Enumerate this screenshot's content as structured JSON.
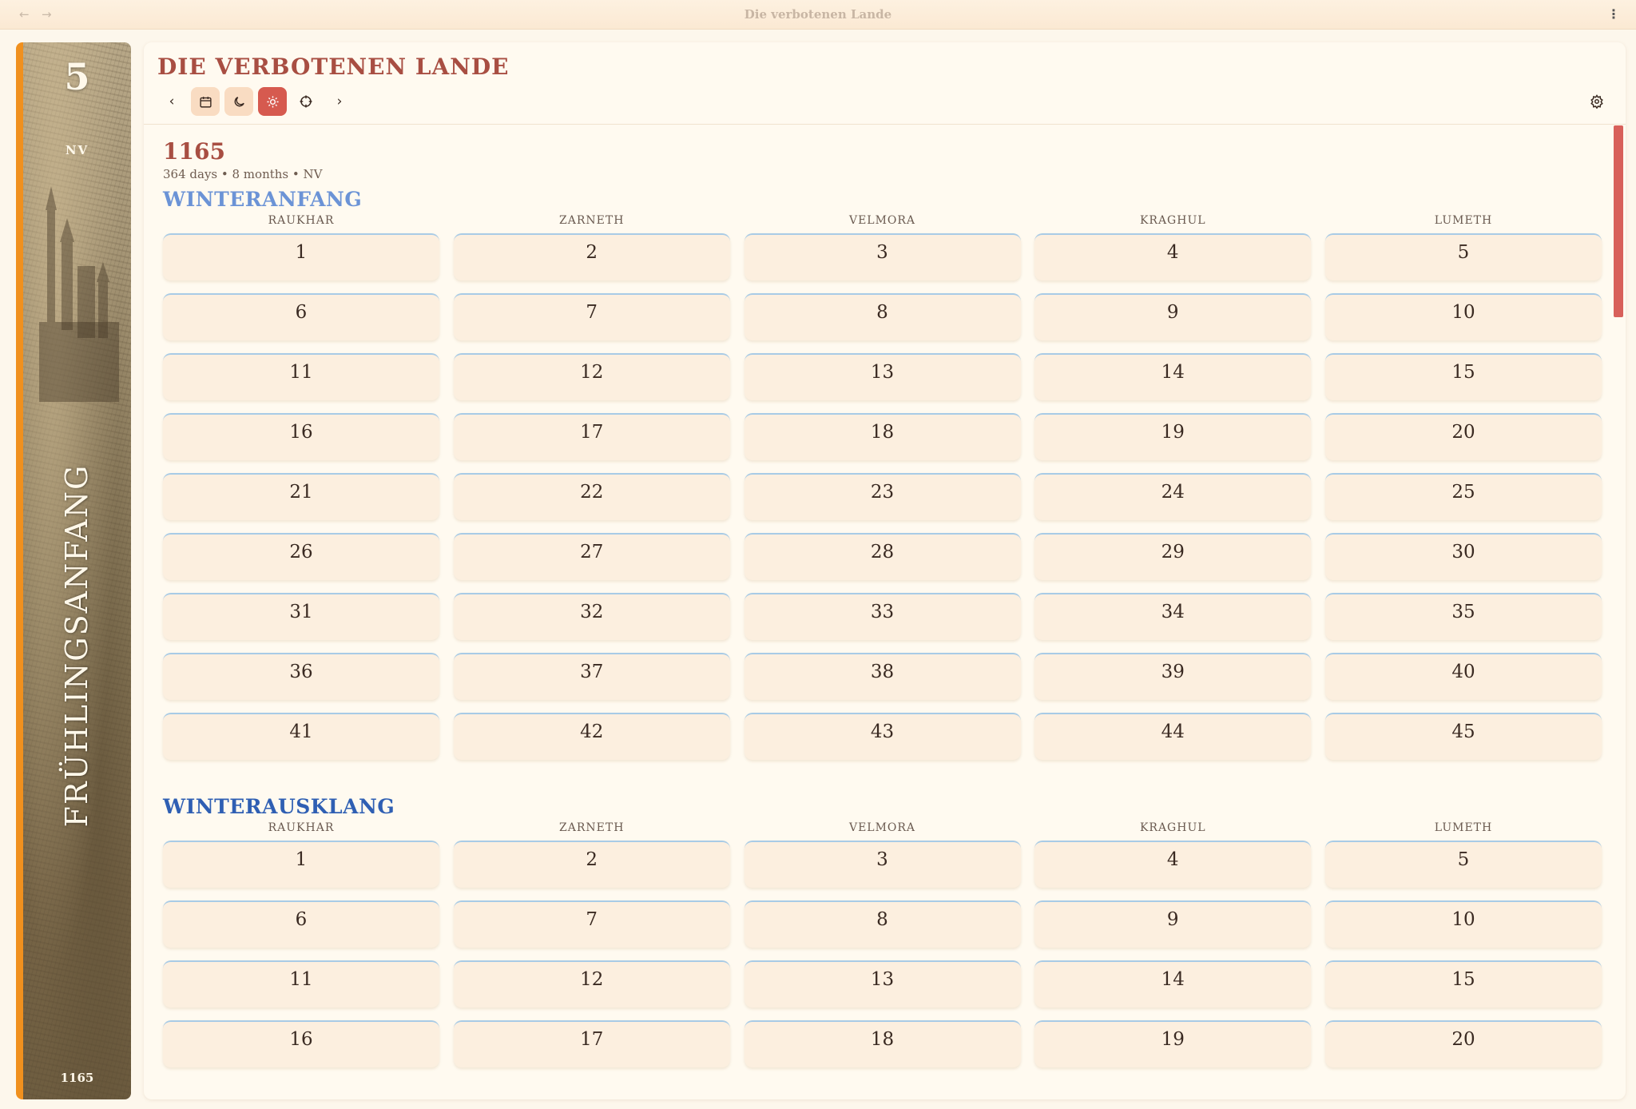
{
  "window": {
    "title": "Die verbotenen Lande",
    "back_icon": "←",
    "forward_icon": "→",
    "menu_icon": "⋮"
  },
  "banner": {
    "day": "5",
    "era": "NV",
    "season": "FRÜHLINGSANFANG",
    "year": "1165",
    "accent_color": "#f0901e"
  },
  "app": {
    "title": "DIE VERBOTENEN LANDE"
  },
  "toolbar": {
    "prev_icon": "‹",
    "next_icon": "›",
    "active_view": "sun"
  },
  "year_header": {
    "year": "1165",
    "meta": "364 days • 8 months • NV"
  },
  "weekdays": [
    "RAUKHAR",
    "ZARNETH",
    "VELMORA",
    "KRAGHUL",
    "LUMETH"
  ],
  "months": [
    {
      "name": "WINTERANFANG",
      "color": "#6b93d6",
      "days": 45
    },
    {
      "name": "WINTERAUSKLANG",
      "color": "#2f5fb3",
      "days": 20
    }
  ],
  "colors": {
    "title": "#a84e42",
    "active_button": "#d65a4f",
    "cell_bg": "#fcefdf"
  }
}
